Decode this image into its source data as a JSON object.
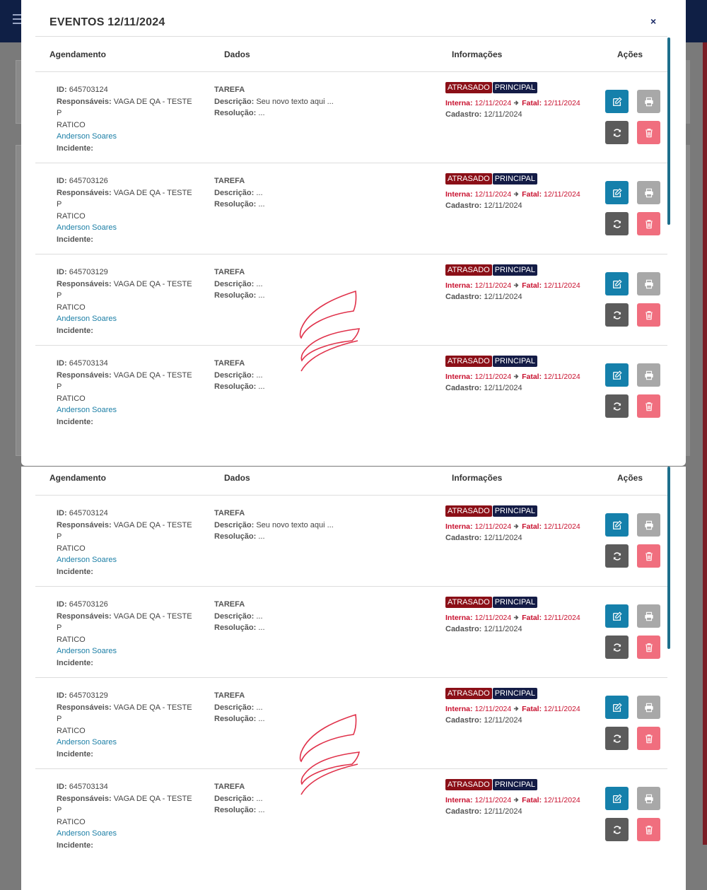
{
  "modal": {
    "title": "EVENTOS 12/11/2024",
    "close_label": "×"
  },
  "table": {
    "headers": {
      "agendamento": "Agendamento",
      "dados": "Dados",
      "informacoes": "Informações",
      "acoes": "Ações"
    },
    "labels": {
      "id": "ID:",
      "responsaveis": "Responsáveis:",
      "incidente": "Incidente:",
      "descricao": "Descrição:",
      "resolucao": "Resolução:",
      "interna": "Interna:",
      "fatal": "Fatal:",
      "cadastro": "Cadastro:"
    },
    "rows": [
      {
        "id": "645703124",
        "responsaveis_l1": "VAGA DE QA - TESTE P",
        "responsaveis_l2": "RATICO",
        "person": "Anderson Soares",
        "tipo": "TAREFA",
        "descricao": "Seu novo texto aqui ...",
        "resolucao": "...",
        "badge_status": "ATRASADO",
        "badge_priority": "PRINCIPAL",
        "interna": "12/11/2024",
        "fatal": "12/11/2024",
        "cadastro": "12/11/2024"
      },
      {
        "id": "645703126",
        "responsaveis_l1": "VAGA DE QA - TESTE P",
        "responsaveis_l2": "RATICO",
        "person": "Anderson Soares",
        "tipo": "TAREFA",
        "descricao": "...",
        "resolucao": "...",
        "badge_status": "ATRASADO",
        "badge_priority": "PRINCIPAL",
        "interna": "12/11/2024",
        "fatal": "12/11/2024",
        "cadastro": "12/11/2024"
      },
      {
        "id": "645703129",
        "responsaveis_l1": "VAGA DE QA - TESTE P",
        "responsaveis_l2": "RATICO",
        "person": "Anderson Soares",
        "tipo": "TAREFA",
        "descricao": "...",
        "resolucao": "...",
        "badge_status": "ATRASADO",
        "badge_priority": "PRINCIPAL",
        "interna": "12/11/2024",
        "fatal": "12/11/2024",
        "cadastro": "12/11/2024"
      },
      {
        "id": "645703134",
        "responsaveis_l1": "VAGA DE QA - TESTE P",
        "responsaveis_l2": "RATICO",
        "person": "Anderson Soares",
        "tipo": "TAREFA",
        "descricao": "...",
        "resolucao": "...",
        "badge_status": "ATRASADO",
        "badge_priority": "PRINCIPAL",
        "interna": "12/11/2024",
        "fatal": "12/11/2024",
        "cadastro": "12/11/2024"
      }
    ]
  },
  "icons": {
    "edit": "edit-icon",
    "print": "print-icon",
    "sync": "sync-icon",
    "delete": "trash-icon",
    "arrow": "arrow-right-icon",
    "close": "close-icon"
  },
  "colors": {
    "badge_status": "#8b0f17",
    "badge_priority": "#141c46",
    "edit": "#1580ab",
    "print": "#a8a8a8",
    "sync": "#5b5b5b",
    "delete": "#f06e7e",
    "date_red": "#c8102e",
    "link": "#1c7fa6"
  }
}
